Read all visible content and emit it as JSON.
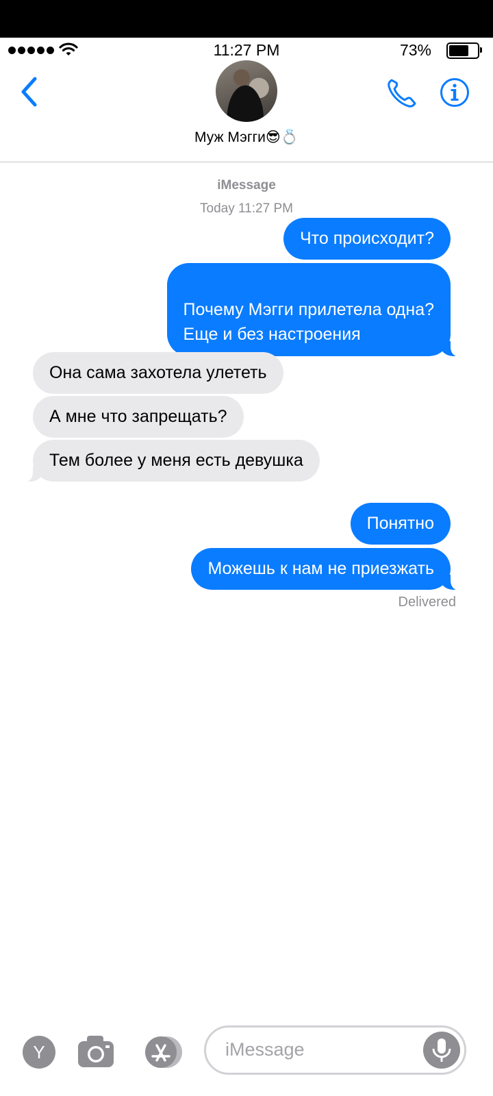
{
  "status_bar": {
    "time": "11:27 PM",
    "battery_percent": "73%",
    "battery_level": 0.73,
    "signal_bars": 5
  },
  "header": {
    "contact_name": "Муж Мэгги😎💍",
    "back_icon": "chevron-left-icon",
    "call_icon": "phone-icon",
    "info_icon": "info-icon"
  },
  "thread": {
    "service_label": "iMessage",
    "timestamp": "Today 11:27 PM",
    "delivered_label": "Delivered",
    "messages": [
      {
        "from": "me",
        "text": "Что происходит?"
      },
      {
        "from": "me",
        "text": "Почему Мэгги прилетела одна?\nЕще и без настроения"
      },
      {
        "from": "them",
        "text": "Она сама захотела улететь"
      },
      {
        "from": "them",
        "text": "А мне что запрещать?"
      },
      {
        "from": "them",
        "text": "Тем более у меня есть девушка"
      },
      {
        "from": "me",
        "text": "Понятно"
      },
      {
        "from": "me",
        "text": "Можешь к нам не приезжать"
      }
    ]
  },
  "compose": {
    "placeholder": "iMessage",
    "app_button_label": "Y",
    "camera_icon": "camera-icon",
    "appstore_icon": "app-store-icon",
    "mic_icon": "microphone-icon"
  },
  "colors": {
    "accent": "#0a7cff",
    "incoming_bubble": "#e9e9eb",
    "meta_text": "#8e8e93"
  }
}
